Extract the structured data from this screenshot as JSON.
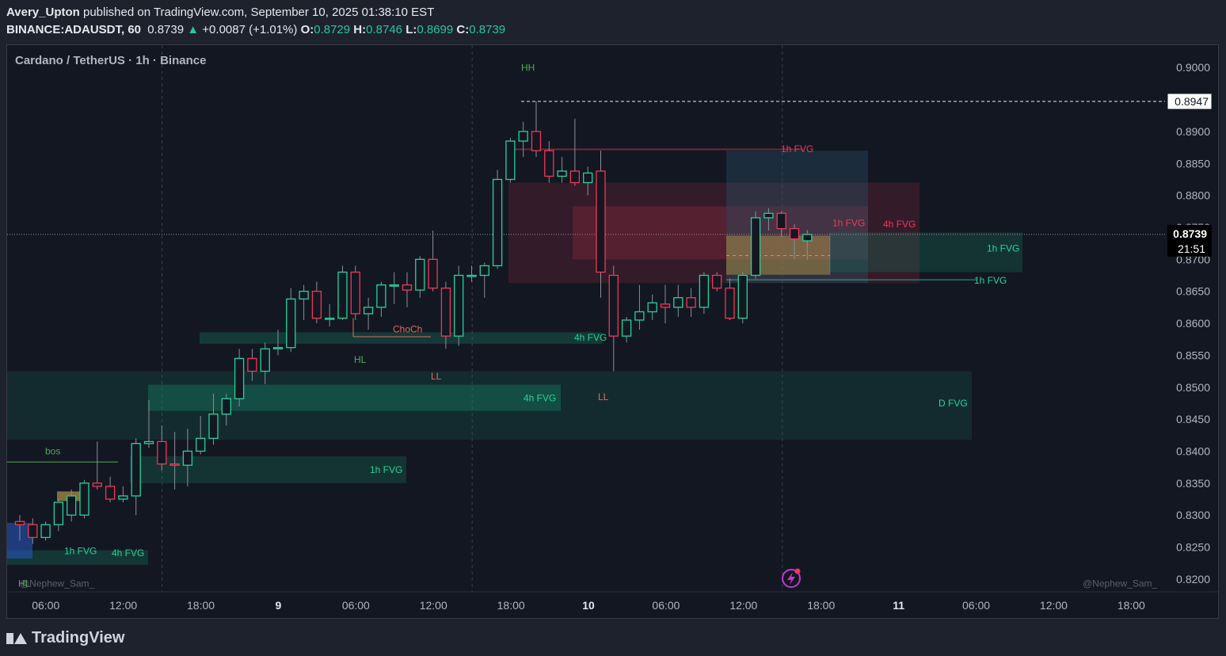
{
  "header": {
    "publisher": "Avery_Upton",
    "published_text": "published on TradingView.com, September 10, 2025 01:38:10 EST",
    "symbol": "BINANCE:ADAUSDT, 60",
    "last": "0.8739",
    "change": "+0.0087 (+1.01%)",
    "o_label": "O:",
    "o": "0.8729",
    "h_label": "H:",
    "h": "0.8746",
    "l_label": "L:",
    "l": "0.8699",
    "c_label": "C:",
    "c": "0.8739"
  },
  "footer": {
    "brand": "TradingView"
  },
  "chart_data": {
    "type": "candlestick",
    "title": "Cardano / TetherUS · 1h · Binance",
    "ylim": [
      0.818,
      0.9035
    ],
    "y_ticks": [
      "0.9000",
      "0.8950",
      "0.8900",
      "0.8850",
      "0.8800",
      "0.8750",
      "0.8700",
      "0.8650",
      "0.8600",
      "0.8550",
      "0.8500",
      "0.8450",
      "0.8400",
      "0.8350",
      "0.8300",
      "0.8250",
      "0.8200"
    ],
    "x_ticks": [
      "06:00",
      "12:00",
      "18:00",
      "9",
      "06:00",
      "12:00",
      "18:00",
      "10",
      "06:00",
      "12:00",
      "18:00",
      "11",
      "06:00",
      "12:00",
      "18:00"
    ],
    "bold_x_ticks": [
      "9",
      "10",
      "11"
    ],
    "current_price": "0.8739",
    "current_countdown": "21:51",
    "hh_level": "0.8947",
    "colors": {
      "up": "#22d49a",
      "down": "#f23657",
      "background": "#131722",
      "text": "#b2b5be"
    },
    "candles": [
      {
        "o": 0.829,
        "h": 0.83,
        "l": 0.826,
        "c": 0.8285
      },
      {
        "o": 0.8285,
        "h": 0.8295,
        "l": 0.8255,
        "c": 0.8265
      },
      {
        "o": 0.8265,
        "h": 0.829,
        "l": 0.826,
        "c": 0.8285
      },
      {
        "o": 0.8285,
        "h": 0.8325,
        "l": 0.8275,
        "c": 0.832
      },
      {
        "o": 0.83,
        "h": 0.834,
        "l": 0.829,
        "c": 0.833
      },
      {
        "o": 0.83,
        "h": 0.8355,
        "l": 0.8295,
        "c": 0.835
      },
      {
        "o": 0.835,
        "h": 0.8415,
        "l": 0.834,
        "c": 0.8345
      },
      {
        "o": 0.8345,
        "h": 0.836,
        "l": 0.832,
        "c": 0.8325
      },
      {
        "o": 0.8325,
        "h": 0.8345,
        "l": 0.832,
        "c": 0.833
      },
      {
        "o": 0.833,
        "h": 0.842,
        "l": 0.83,
        "c": 0.8412
      },
      {
        "o": 0.8412,
        "h": 0.848,
        "l": 0.8405,
        "c": 0.8415
      },
      {
        "o": 0.8415,
        "h": 0.844,
        "l": 0.837,
        "c": 0.838
      },
      {
        "o": 0.838,
        "h": 0.843,
        "l": 0.834,
        "c": 0.8378
      },
      {
        "o": 0.8378,
        "h": 0.8435,
        "l": 0.8345,
        "c": 0.84
      },
      {
        "o": 0.84,
        "h": 0.8455,
        "l": 0.8395,
        "c": 0.842
      },
      {
        "o": 0.842,
        "h": 0.849,
        "l": 0.841,
        "c": 0.8458
      },
      {
        "o": 0.8458,
        "h": 0.849,
        "l": 0.844,
        "c": 0.8482
      },
      {
        "o": 0.8482,
        "h": 0.856,
        "l": 0.847,
        "c": 0.8545
      },
      {
        "o": 0.8545,
        "h": 0.856,
        "l": 0.851,
        "c": 0.8525
      },
      {
        "o": 0.8525,
        "h": 0.857,
        "l": 0.8505,
        "c": 0.856
      },
      {
        "o": 0.856,
        "h": 0.859,
        "l": 0.855,
        "c": 0.8562
      },
      {
        "o": 0.8562,
        "h": 0.8655,
        "l": 0.8555,
        "c": 0.8638
      },
      {
        "o": 0.8638,
        "h": 0.866,
        "l": 0.8605,
        "c": 0.865
      },
      {
        "o": 0.865,
        "h": 0.8665,
        "l": 0.86,
        "c": 0.8608
      },
      {
        "o": 0.8608,
        "h": 0.863,
        "l": 0.8595,
        "c": 0.8608
      },
      {
        "o": 0.8608,
        "h": 0.869,
        "l": 0.8605,
        "c": 0.868
      },
      {
        "o": 0.868,
        "h": 0.869,
        "l": 0.8605,
        "c": 0.8615
      },
      {
        "o": 0.8615,
        "h": 0.864,
        "l": 0.859,
        "c": 0.8625
      },
      {
        "o": 0.8625,
        "h": 0.8665,
        "l": 0.861,
        "c": 0.866
      },
      {
        "o": 0.866,
        "h": 0.868,
        "l": 0.863,
        "c": 0.866
      },
      {
        "o": 0.866,
        "h": 0.868,
        "l": 0.8625,
        "c": 0.8652
      },
      {
        "o": 0.8652,
        "h": 0.8705,
        "l": 0.864,
        "c": 0.87
      },
      {
        "o": 0.87,
        "h": 0.8745,
        "l": 0.865,
        "c": 0.8655
      },
      {
        "o": 0.8655,
        "h": 0.8665,
        "l": 0.856,
        "c": 0.858
      },
      {
        "o": 0.858,
        "h": 0.869,
        "l": 0.8565,
        "c": 0.8675
      },
      {
        "o": 0.8675,
        "h": 0.869,
        "l": 0.8665,
        "c": 0.8675
      },
      {
        "o": 0.8675,
        "h": 0.8695,
        "l": 0.864,
        "c": 0.869
      },
      {
        "o": 0.869,
        "h": 0.884,
        "l": 0.8685,
        "c": 0.8825
      },
      {
        "o": 0.8825,
        "h": 0.889,
        "l": 0.882,
        "c": 0.8885
      },
      {
        "o": 0.8885,
        "h": 0.8915,
        "l": 0.886,
        "c": 0.89
      },
      {
        "o": 0.89,
        "h": 0.8947,
        "l": 0.886,
        "c": 0.887
      },
      {
        "o": 0.887,
        "h": 0.8885,
        "l": 0.882,
        "c": 0.883
      },
      {
        "o": 0.883,
        "h": 0.886,
        "l": 0.882,
        "c": 0.8838
      },
      {
        "o": 0.8838,
        "h": 0.892,
        "l": 0.8815,
        "c": 0.882
      },
      {
        "o": 0.882,
        "h": 0.8845,
        "l": 0.88,
        "c": 0.8835
      },
      {
        "o": 0.8838,
        "h": 0.887,
        "l": 0.864,
        "c": 0.868
      },
      {
        "o": 0.8675,
        "h": 0.869,
        "l": 0.8525,
        "c": 0.858
      },
      {
        "o": 0.858,
        "h": 0.861,
        "l": 0.857,
        "c": 0.8605
      },
      {
        "o": 0.8605,
        "h": 0.866,
        "l": 0.859,
        "c": 0.8618
      },
      {
        "o": 0.8618,
        "h": 0.8645,
        "l": 0.8605,
        "c": 0.8632
      },
      {
        "o": 0.863,
        "h": 0.866,
        "l": 0.86,
        "c": 0.8625
      },
      {
        "o": 0.8625,
        "h": 0.866,
        "l": 0.861,
        "c": 0.864
      },
      {
        "o": 0.864,
        "h": 0.8655,
        "l": 0.861,
        "c": 0.8625
      },
      {
        "o": 0.8625,
        "h": 0.868,
        "l": 0.8615,
        "c": 0.8675
      },
      {
        "o": 0.8675,
        "h": 0.868,
        "l": 0.865,
        "c": 0.8655
      },
      {
        "o": 0.8655,
        "h": 0.867,
        "l": 0.8605,
        "c": 0.8608
      },
      {
        "o": 0.8608,
        "h": 0.868,
        "l": 0.86,
        "c": 0.8675
      },
      {
        "o": 0.8675,
        "h": 0.8775,
        "l": 0.867,
        "c": 0.8765
      },
      {
        "o": 0.8765,
        "h": 0.878,
        "l": 0.8745,
        "c": 0.8772
      },
      {
        "o": 0.8772,
        "h": 0.8775,
        "l": 0.8735,
        "c": 0.8748
      },
      {
        "o": 0.8748,
        "h": 0.8755,
        "l": 0.87,
        "c": 0.8732
      },
      {
        "o": 0.8729,
        "h": 0.8746,
        "l": 0.8699,
        "c": 0.8739
      }
    ],
    "annotations": [
      {
        "text": "HH"
      },
      {
        "text": "HL"
      },
      {
        "text": "LL"
      },
      {
        "text": "LL"
      },
      {
        "text": "ChoCh"
      },
      {
        "text": "bos"
      },
      {
        "text": "HL"
      },
      {
        "text": "1h FVG"
      },
      {
        "text": "1h FVG"
      },
      {
        "text": "1h FVG"
      },
      {
        "text": "1h FVG"
      },
      {
        "text": "1h FVG"
      },
      {
        "text": "4h FVG"
      },
      {
        "text": "4h FVG"
      },
      {
        "text": "4h FVG"
      },
      {
        "text": "4h FVG"
      },
      {
        "text": "D FVG"
      }
    ],
    "watermark": "@Nephew_Sam_"
  }
}
